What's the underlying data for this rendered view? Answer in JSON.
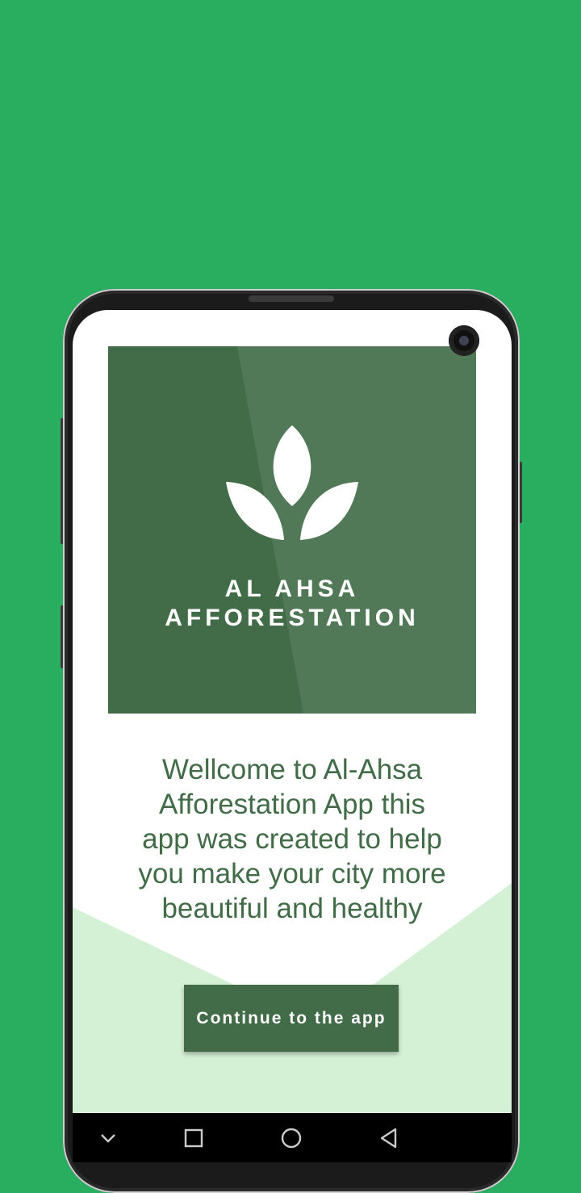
{
  "logo": {
    "line1": "AL AHSA",
    "line2": "AFFORESTATION"
  },
  "welcome_text": "Wellcome to Al-Ahsa Afforestation App this app was created to help you make your city more beautiful and healthy",
  "cta": {
    "label": "Continue to the app"
  },
  "colors": {
    "background": "#29ae60",
    "brand": "#416c47",
    "accent_light": "#d5f1d5"
  },
  "navbar": {
    "icons": [
      "chevron-down-icon",
      "recents-icon",
      "home-icon",
      "back-icon"
    ]
  }
}
